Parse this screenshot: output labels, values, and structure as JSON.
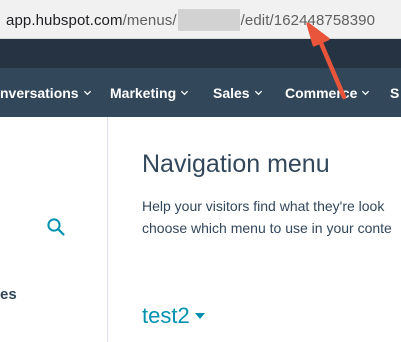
{
  "browser": {
    "url_domain": "app.hubspot.com",
    "url_path_before": "/menus/",
    "url_path_after": "/edit/162448758390"
  },
  "nav": {
    "items": [
      {
        "label": "nversations"
      },
      {
        "label": "Marketing"
      },
      {
        "label": "Sales"
      },
      {
        "label": "Commerce"
      },
      {
        "label": "S"
      }
    ]
  },
  "sidebar": {
    "partial_label": "es"
  },
  "main": {
    "title": "Navigation menu",
    "description_line1": "Help your visitors find what they're look",
    "description_line2": "choose which menu to use in your conte",
    "menu_name": "test2"
  },
  "colors": {
    "nav_bg": "#33475b",
    "top_strip_bg": "#253342",
    "link": "#0091ae",
    "arrow": "#e8553a"
  },
  "icons": [
    "search-icon",
    "chevron-down-icon",
    "caret-down-icon",
    "arrow-annotation"
  ]
}
